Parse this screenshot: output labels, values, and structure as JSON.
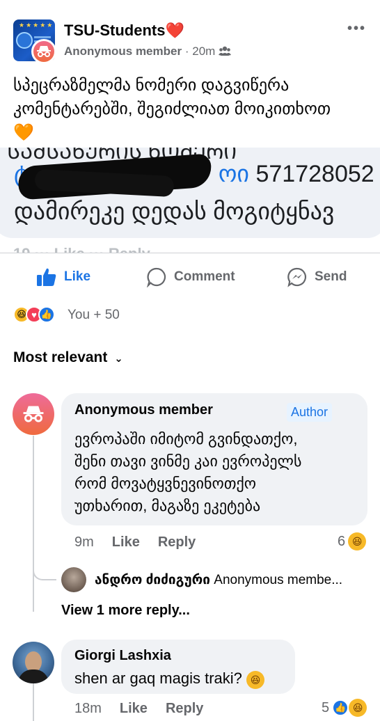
{
  "post": {
    "group_name": "TSU-Students",
    "group_emoji": "❤️",
    "author": "Anonymous member",
    "time": "20m",
    "separator": "·",
    "audience_icon": "group-audience-icon",
    "text": "სპეცრაზმელმა ნომერი დაგვიწერა კომენტარებში, შეგიძლიათ მოიკითხოთ",
    "text_emoji": "🧡",
    "snippet": {
      "phone_prefix": "ტ",
      "phone_suffix": "ოი",
      "phone_number": "571728052",
      "sentence": "დამირეკე დედას მოგიტყნავ"
    }
  },
  "actions": {
    "like": "Like",
    "comment": "Comment",
    "send": "Send"
  },
  "reactions": {
    "summary": "You + 50",
    "icons": [
      "haha",
      "love",
      "like"
    ]
  },
  "sort_label": "Most relevant",
  "comments": [
    {
      "author": "Anonymous member",
      "badge": "Author",
      "text_lines": [
        "ევროპაში იმიტომ გვინდათქო,",
        "შენი თავი ვინმე კაი ევროპელს",
        "რომ მოვატყვნევინოთქო",
        "უთხარით, მაგაზე ეკეტება"
      ],
      "time": "9m",
      "like": "Like",
      "reply": "Reply",
      "reaction_count": "6"
    },
    {
      "author": "Giorgi Lashxia",
      "text": "shen ar gaq magis traki?",
      "time": "18m",
      "like": "Like",
      "reply": "Reply",
      "reaction_count": "5"
    }
  ],
  "reply_preview": {
    "name": "ანდრო ძიძიგური",
    "text": "Anonymous membe..."
  },
  "view_more": "View 1 more reply...",
  "colors": {
    "accent": "#1b74e4",
    "secondary_text": "#65676b",
    "bubble": "#f0f2f5"
  }
}
